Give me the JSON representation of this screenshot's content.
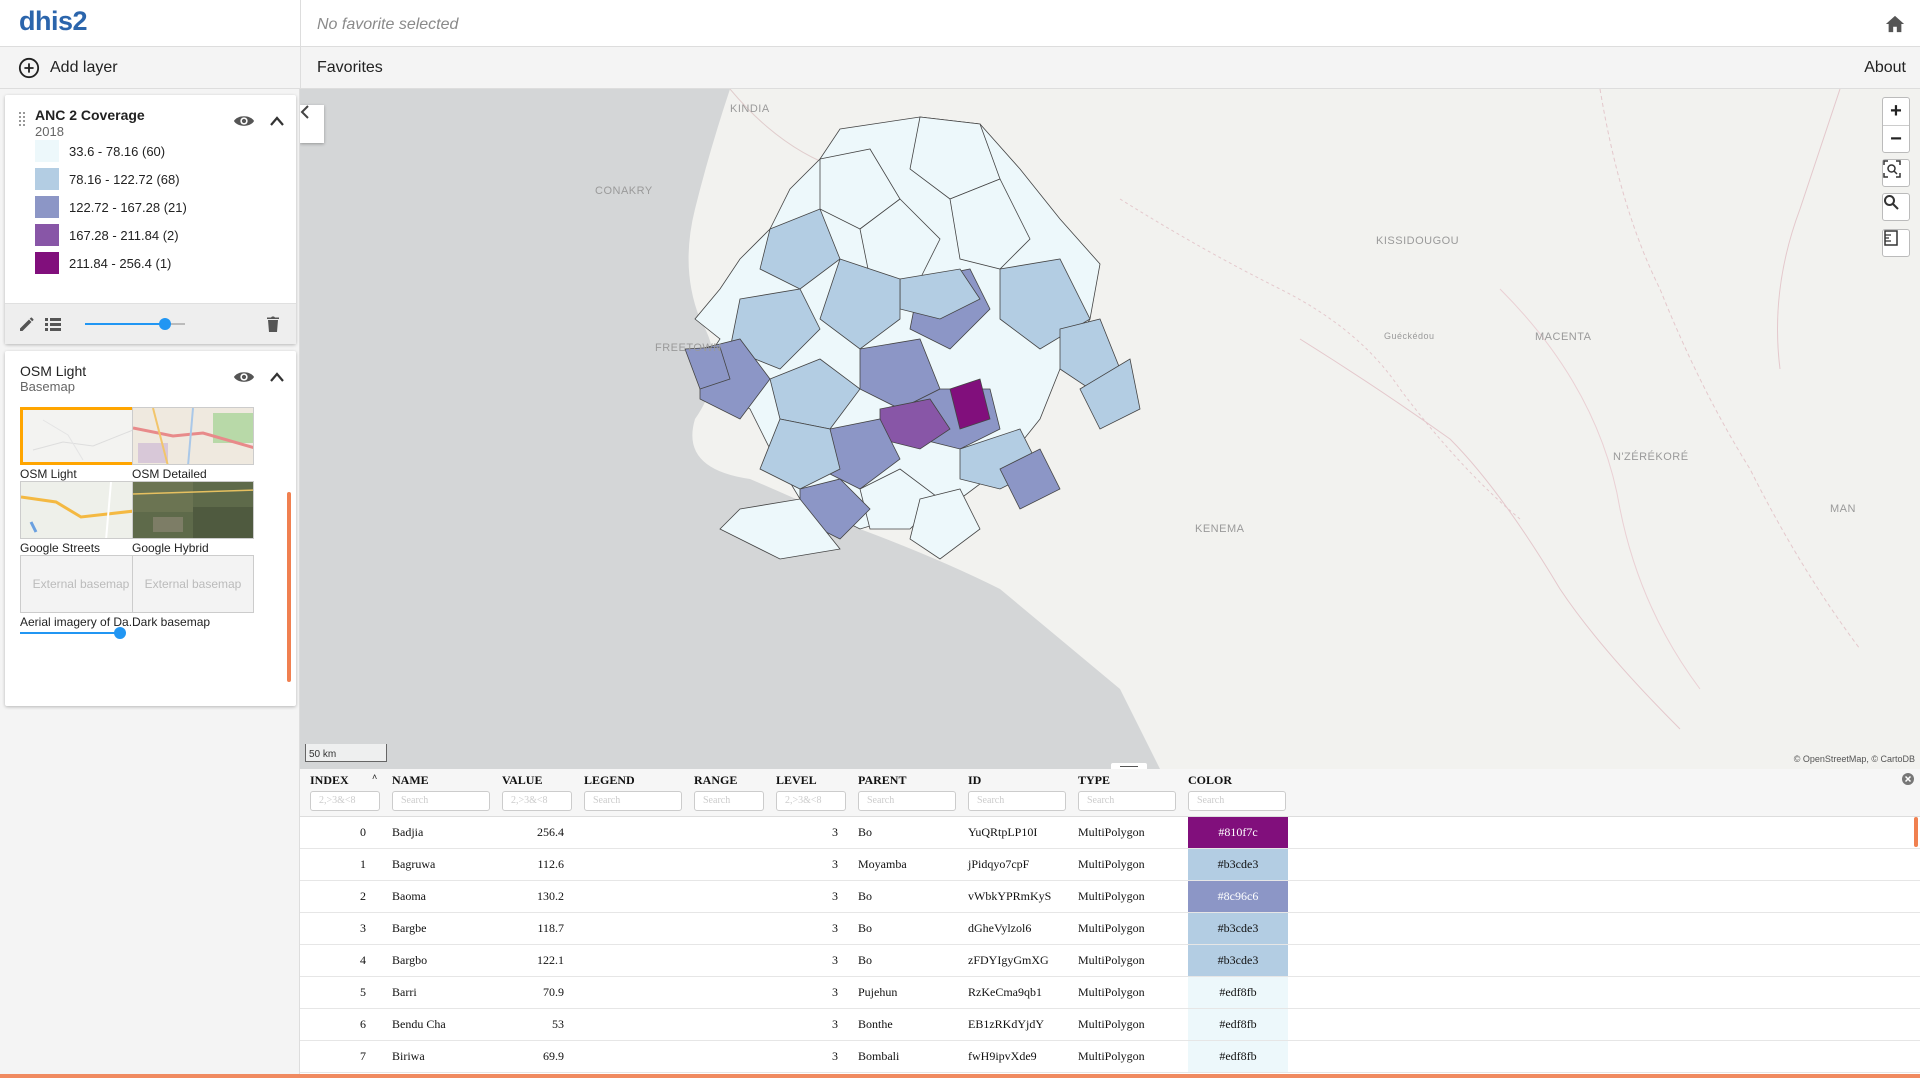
{
  "app": {
    "logo": "dhis2",
    "favorite_title": "No favorite selected"
  },
  "toolbar": {
    "add_layer": "Add layer",
    "favorites": "Favorites",
    "about": "About"
  },
  "layer": {
    "title": "ANC 2 Coverage",
    "period": "2018",
    "legend": [
      {
        "label": "33.6 - 78.16 (60)",
        "color": "#edf8fb"
      },
      {
        "label": "78.16 - 122.72 (68)",
        "color": "#b3cde3"
      },
      {
        "label": "122.72 - 167.28 (21)",
        "color": "#8c96c6"
      },
      {
        "label": "167.28 - 211.84 (2)",
        "color": "#8856a7"
      },
      {
        "label": "211.84 - 256.4 (1)",
        "color": "#810f7c"
      }
    ],
    "opacity": 0.8
  },
  "basemap": {
    "title": "OSM Light",
    "subtitle": "Basemap",
    "options": [
      {
        "label": "OSM Light",
        "selected": true
      },
      {
        "label": "OSM Detailed",
        "selected": false
      },
      {
        "label": "Google Streets",
        "selected": false
      },
      {
        "label": "Google Hybrid",
        "selected": false
      },
      {
        "label": "Aerial imagery of Da...",
        "selected": false,
        "placeholder": "External basemap"
      },
      {
        "label": "Dark basemap",
        "selected": false,
        "placeholder": "External basemap"
      }
    ],
    "opacity": 1.0
  },
  "map": {
    "labels": [
      "KINDIA",
      "CONAKRY",
      "KISSIDOUGOU",
      "Guéckédou",
      "MACENTA",
      "FREETOWN",
      "N'ZÉRÉKORÉ",
      "MAN",
      "KENEMA"
    ],
    "scale": "50 km",
    "attribution": "© OpenStreetMap, © CartoDB"
  },
  "table": {
    "columns": [
      "INDEX",
      "NAME",
      "VALUE",
      "LEGEND",
      "RANGE",
      "LEVEL",
      "PARENT",
      "ID",
      "TYPE",
      "COLOR"
    ],
    "filters": [
      "2,>3&<8",
      "Search",
      "2,>3&<8",
      "Search",
      "Search",
      "2,>3&<8",
      "Search",
      "Search",
      "Search",
      "Search"
    ],
    "rows": [
      {
        "index": "0",
        "name": "Badjia",
        "value": "256.4",
        "level": "3",
        "parent": "Bo",
        "id": "YuQRtpLP10I",
        "type": "MultiPolygon",
        "color": "#810f7c"
      },
      {
        "index": "1",
        "name": "Bagruwa",
        "value": "112.6",
        "level": "3",
        "parent": "Moyamba",
        "id": "jPidqyo7cpF",
        "type": "MultiPolygon",
        "color": "#b3cde3"
      },
      {
        "index": "2",
        "name": "Baoma",
        "value": "130.2",
        "level": "3",
        "parent": "Bo",
        "id": "vWbkYPRmKyS",
        "type": "MultiPolygon",
        "color": "#8c96c6"
      },
      {
        "index": "3",
        "name": "Bargbe",
        "value": "118.7",
        "level": "3",
        "parent": "Bo",
        "id": "dGheVylzol6",
        "type": "MultiPolygon",
        "color": "#b3cde3"
      },
      {
        "index": "4",
        "name": "Bargbo",
        "value": "122.1",
        "level": "3",
        "parent": "Bo",
        "id": "zFDYIgyGmXG",
        "type": "MultiPolygon",
        "color": "#b3cde3"
      },
      {
        "index": "5",
        "name": "Barri",
        "value": "70.9",
        "level": "3",
        "parent": "Pujehun",
        "id": "RzKeCma9qb1",
        "type": "MultiPolygon",
        "color": "#edf8fb"
      },
      {
        "index": "6",
        "name": "Bendu Cha",
        "value": "53",
        "level": "3",
        "parent": "Bonthe",
        "id": "EB1zRKdYjdY",
        "type": "MultiPolygon",
        "color": "#edf8fb"
      },
      {
        "index": "7",
        "name": "Biriwa",
        "value": "69.9",
        "level": "3",
        "parent": "Bombali",
        "id": "fwH9ipvXde9",
        "type": "MultiPolygon",
        "color": "#edf8fb"
      }
    ]
  }
}
